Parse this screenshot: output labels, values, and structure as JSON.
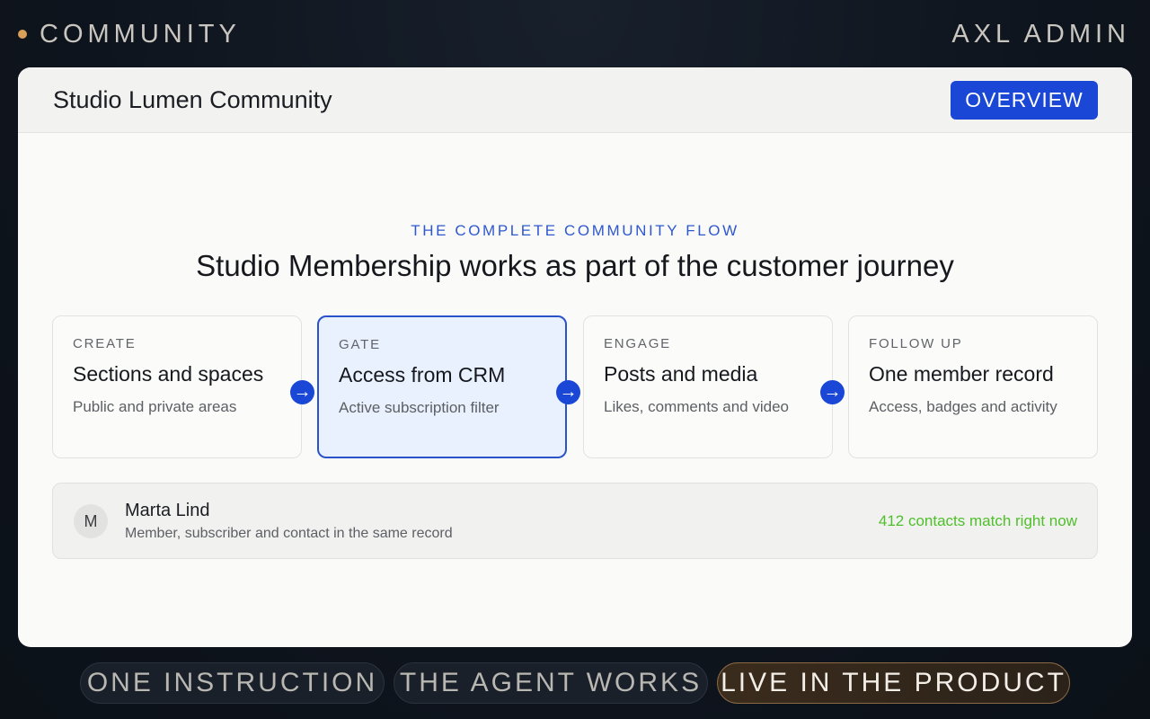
{
  "topbar": {
    "brand": "COMMUNITY",
    "admin": "AXL ADMIN",
    "colors": {
      "dot": "#d9a05a",
      "background": "#0e141d"
    }
  },
  "window": {
    "title": "Studio Lumen Community",
    "overview_label": "OVERVIEW",
    "accent": "#1a47d6"
  },
  "hero": {
    "eyebrow": "THE COMPLETE COMMUNITY FLOW",
    "headline": "Studio Membership works as part of the customer journey"
  },
  "steps": [
    {
      "eyebrow": "CREATE",
      "title": "Sections and spaces",
      "sub": "Public and private areas",
      "active": false
    },
    {
      "eyebrow": "GATE",
      "title": "Access from CRM",
      "sub": "Active subscription filter",
      "active": true
    },
    {
      "eyebrow": "ENGAGE",
      "title": "Posts and media",
      "sub": "Likes, comments and video",
      "active": false
    },
    {
      "eyebrow": "FOLLOW UP",
      "title": "One member record",
      "sub": "Access, badges and activity",
      "active": false
    }
  ],
  "arrow_glyph": "→",
  "member": {
    "initial": "M",
    "name": "Marta Lind",
    "sub": "Member, subscriber and contact in the same record",
    "count": "412 contacts match right now",
    "count_color": "#4fbf2a"
  },
  "pills": [
    {
      "label": "ONE INSTRUCTION",
      "active": false
    },
    {
      "label": "THE AGENT WORKS",
      "active": false
    },
    {
      "label": "LIVE IN THE PRODUCT",
      "active": true
    }
  ]
}
